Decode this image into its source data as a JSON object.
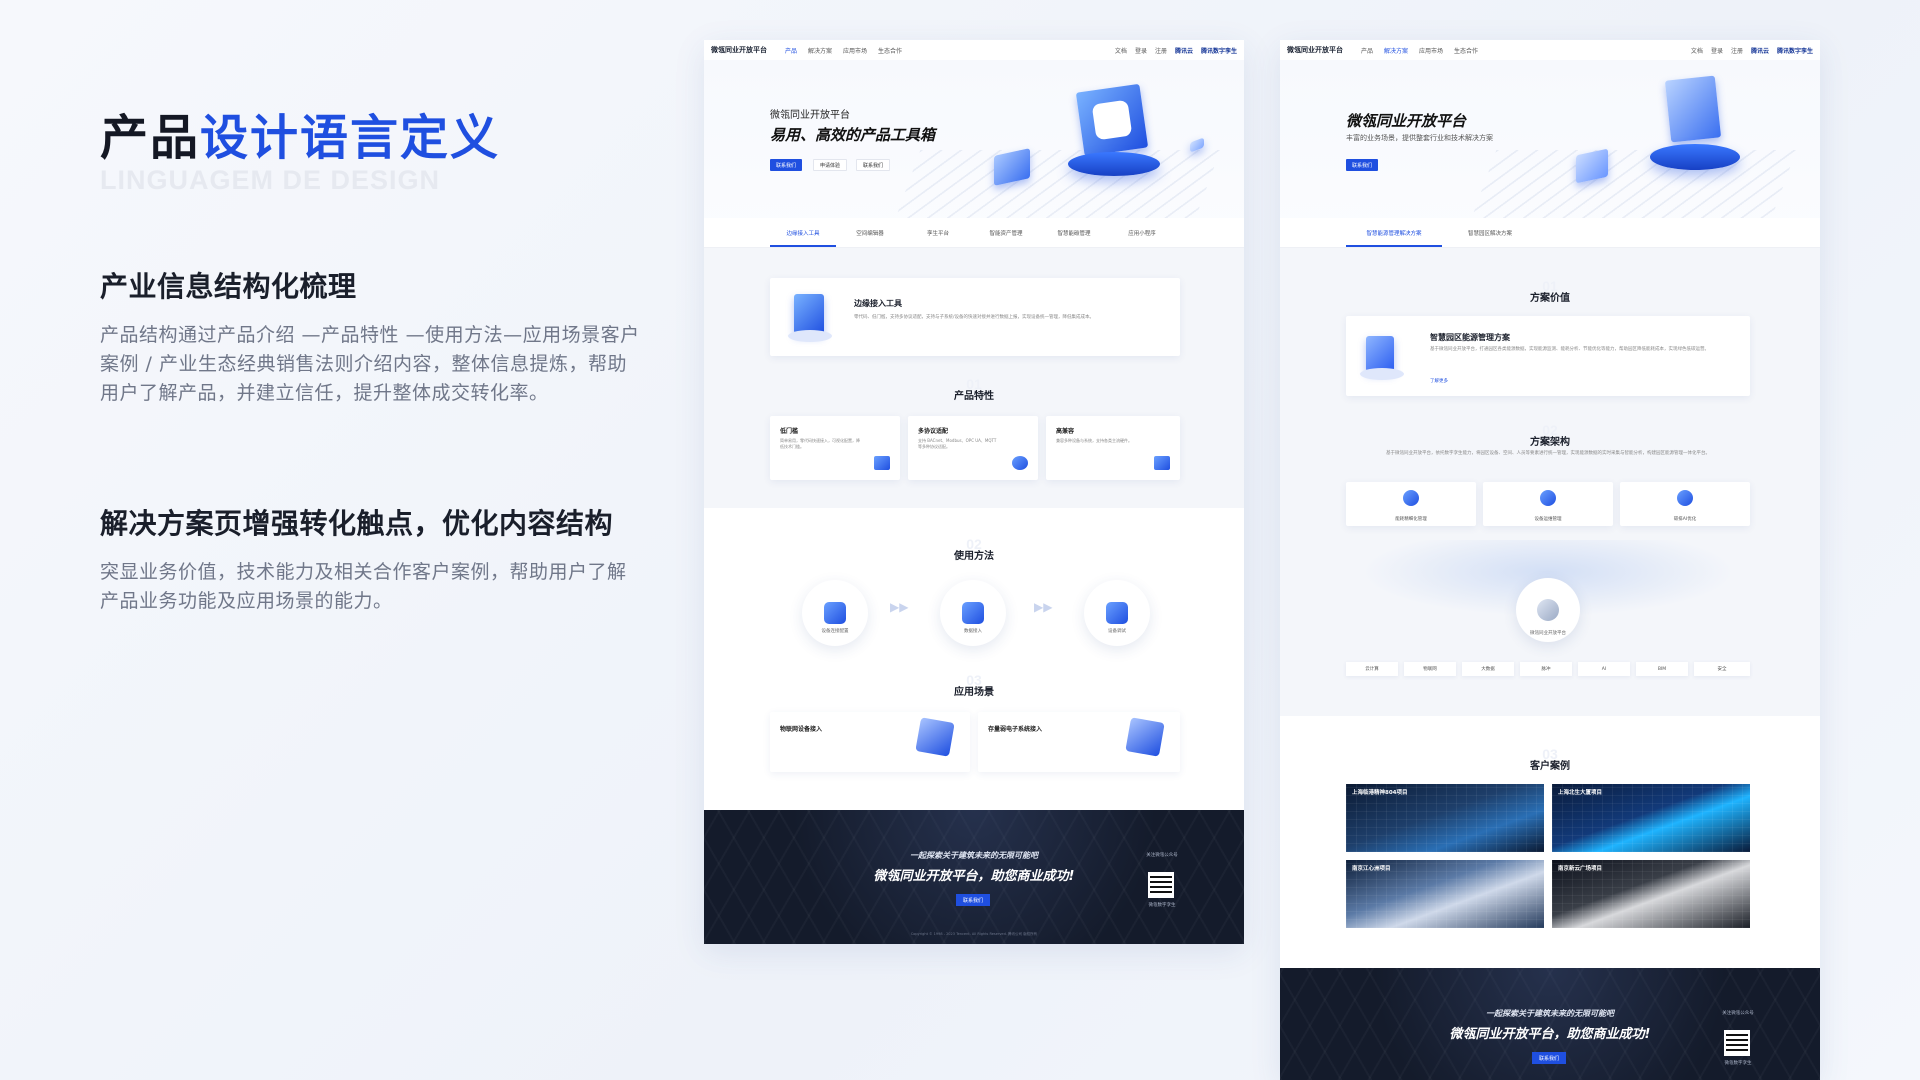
{
  "left": {
    "title_part1": "产品",
    "title_part2": "设计语言定义",
    "subtitle_en": "LINGUAGEM DE DESIGN",
    "section1": {
      "heading": "产业信息结构化梳理",
      "body": "产品结构通过产品介绍 —产品特性 —使用方法—应用场景客户案例 / 产业生态经典销售法则介绍内容，整体信息提炼，帮助用户了解产品，并建立信任，提升整体成交转化率。"
    },
    "section2": {
      "heading": "解决方案页增强转化触点，优化内容结构",
      "body": "突显业务价值，技术能力及相关合作客户案例，帮助用户了解产品业务功能及应用场景的能力。"
    }
  },
  "mock1": {
    "nav": {
      "logo": "微瓴同业开放平台",
      "items": [
        "产品",
        "解决方案",
        "应用市场",
        "生态合作"
      ],
      "right": [
        "文档",
        "登录",
        "注册",
        "腾讯云",
        "腾讯数字孪生"
      ]
    },
    "hero": {
      "small": "微瓴同业开放平台",
      "big": "易用、高效的产品工具箱",
      "btn_primary": "联系我们",
      "btn_2": "申请体验",
      "btn_3": "联系我们"
    },
    "tabs": [
      "边缘接入工具",
      "空间编辑器",
      "孪生平台",
      "智能资产管理",
      "智慧能碳管理",
      "应用小程序"
    ],
    "intro_card": {
      "title": "边缘接入工具",
      "text": "零代码、低门槛，支持多协议适配，支持与子系统/设备的快速对接并进行数据上报，实现设备统一管理，降低集成成本。"
    },
    "features": {
      "num": "01",
      "title": "产品特性",
      "items": [
        {
          "title": "低门槛",
          "desc": "简单易用，零代码快速接入，可视化配置，降低技术门槛。"
        },
        {
          "title": "多协议适配",
          "desc": "支持 BACnet、Modbus、OPC UA、MQTT 等多种协议适配。"
        },
        {
          "title": "高兼容",
          "desc": "兼容多种设备与系统，支持各类主流硬件。"
        }
      ]
    },
    "usage": {
      "num": "02",
      "title": "使用方法",
      "steps": [
        "设备连接配置",
        "数据接入",
        "设备调试"
      ]
    },
    "scenes": {
      "num": "03",
      "title": "应用场景",
      "items": [
        "物联网设备接入",
        "存量弱电子系统接入"
      ]
    },
    "footer": {
      "small": "一起探索关于建筑未来的无限可能吧",
      "big": "微瓴同业开放平台，助您商业成功!",
      "btn": "联系我们",
      "qr_title": "关注微瓴公众号",
      "qr_caption": "微瓴数字孪生",
      "copyright": "Copyright © 1998 - 2023 Tencent. All Rights Reserved. 腾讯公司 版权所有"
    }
  },
  "mock2": {
    "nav": {
      "logo": "微瓴同业开放平台",
      "items": [
        "产品",
        "解决方案",
        "应用市场",
        "生态合作"
      ],
      "right": [
        "文档",
        "登录",
        "注册",
        "腾讯云",
        "腾讯数字孪生"
      ]
    },
    "hero": {
      "big": "微瓴同业开放平台",
      "desc": "丰富的业务场景，提供整套行业和技术解决方案",
      "btn_primary": "联系我们"
    },
    "tabs": [
      "智慧能源管理解决方案",
      "智慧园区解决方案"
    ],
    "value": {
      "num": "01",
      "title": "方案价值",
      "card_title": "智慧园区能源管理方案",
      "card_text": "基于微瓴同业开放平台，打通园区各类能源数据，实现能源监测、能耗分析、节能优化等能力，帮助园区降低能耗成本，实现绿色低碳运营。",
      "card_link": "了解更多"
    },
    "arch": {
      "num": "02",
      "title": "方案架构",
      "text": "基于微瓴同业开放平台，依托数字孪生能力，将园区设备、空间、人员等要素进行统一管理，实现能源数据的实时采集与智能分析，构建园区能源管理一体化平台。",
      "cards": [
        "能耗精细化管理",
        "设备运维管理",
        "碳排AI优化"
      ],
      "center": "微瓴同业开放平台",
      "techs": [
        "云计算",
        "物联网",
        "大数据",
        "脉冲",
        "AI",
        "BIM",
        "安全"
      ]
    },
    "cases": {
      "num": "03",
      "title": "客户案例",
      "items": [
        "上海临港精神804项目",
        "上海北生大厦项目",
        "南京江心洲项目",
        "南京新云广场项目"
      ]
    },
    "footer": {
      "small": "一起探索关于建筑未来的无限可能吧",
      "big": "微瓴同业开放平台，助您商业成功!",
      "btn": "联系我们",
      "qr_title": "关注微瓴公众号",
      "qr_caption": "微瓴数字孪生"
    }
  }
}
